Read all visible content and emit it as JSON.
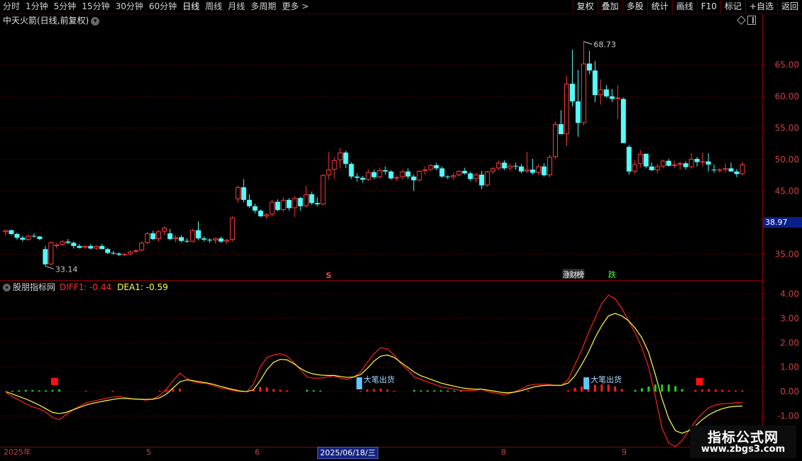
{
  "toolbar": {
    "periods": [
      "分时",
      "1分钟",
      "5分钟",
      "15分钟",
      "30分钟",
      "60分钟",
      "日线",
      "周线",
      "月线",
      "多周期",
      "更多 >"
    ],
    "buttons": [
      "复权",
      "叠加",
      "多股",
      "统计",
      "画线",
      "F10",
      "标记",
      "+自选",
      "返回"
    ]
  },
  "stock": {
    "title": "中天火箭(日线,前复权)"
  },
  "price_panel": {
    "y_ticks": [
      "65.00",
      "60.00",
      "55.00",
      "50.00",
      "45.00",
      "35.00"
    ],
    "high_label": "68.73",
    "low_label": "33.14",
    "current_price_tag": "38.97",
    "marker_s": "S",
    "event_labels": [
      "涨",
      "财",
      "榜",
      "跌"
    ]
  },
  "indicator_panel": {
    "name": "股朋指标网",
    "diff_label": "DIFF1: -0.44",
    "dea_label": "DEA1: -0.59",
    "y_ticks": [
      "4.00",
      "3.00",
      "2.00",
      "1.00",
      "0.00",
      "-1.00"
    ],
    "signal_label": "大笔出货"
  },
  "x_axis": {
    "labels": [
      "2025年",
      "5",
      "6",
      "8",
      "9"
    ],
    "cursor_date": "2025/06/18/三"
  },
  "watermark": {
    "title": "指标公式网",
    "url": "www.zbgs3.com"
  },
  "colors": {
    "up": "#ff3b3b",
    "down": "#54fcfc",
    "diff": "#ff2020",
    "dea": "#ffff40",
    "grid": "#8b0000",
    "axis_text": "#d04040"
  },
  "chart_data": [
    {
      "type": "candlestick",
      "title": "中天火箭(日线,前复权)",
      "ylim": [
        31,
        71
      ],
      "y_ticks": [
        35,
        45,
        50,
        55,
        60,
        65
      ],
      "candles": [
        [
          38.5,
          38.9,
          38.0,
          38.8
        ],
        [
          38.8,
          38.9,
          38.0,
          38.2
        ],
        [
          38.2,
          38.4,
          37.3,
          37.6
        ],
        [
          37.6,
          37.9,
          37.0,
          37.3
        ],
        [
          37.3,
          38.1,
          37.1,
          37.9
        ],
        [
          37.9,
          38.3,
          37.6,
          37.8
        ],
        [
          37.8,
          37.9,
          37.2,
          37.4
        ],
        [
          35.8,
          36.3,
          33.1,
          33.4
        ],
        [
          33.4,
          37.0,
          33.2,
          36.9
        ],
        [
          36.3,
          36.8,
          35.9,
          36.5
        ],
        [
          36.5,
          37.2,
          36.3,
          37.0
        ],
        [
          37.0,
          37.4,
          36.6,
          36.8
        ],
        [
          36.8,
          37.0,
          35.9,
          36.3
        ],
        [
          36.3,
          36.6,
          35.9,
          36.0
        ],
        [
          36.0,
          36.4,
          35.9,
          36.3
        ],
        [
          36.3,
          36.6,
          35.8,
          35.9
        ],
        [
          35.9,
          36.4,
          35.7,
          36.3
        ],
        [
          36.3,
          36.6,
          35.9,
          35.8
        ],
        [
          35.8,
          36.0,
          35.0,
          35.2
        ],
        [
          35.2,
          35.5,
          34.9,
          35.1
        ],
        [
          35.1,
          35.3,
          34.7,
          34.9
        ],
        [
          34.9,
          35.2,
          34.7,
          35.0
        ],
        [
          35.0,
          35.6,
          34.8,
          35.4
        ],
        [
          35.4,
          35.8,
          35.2,
          35.6
        ],
        [
          35.6,
          37.0,
          35.4,
          36.8
        ],
        [
          36.8,
          38.5,
          36.6,
          38.3
        ],
        [
          38.3,
          38.7,
          37.2,
          37.4
        ],
        [
          37.4,
          38.8,
          37.0,
          38.6
        ],
        [
          38.6,
          39.4,
          38.0,
          39.2
        ],
        [
          38.3,
          39.0,
          37.2,
          37.4
        ],
        [
          37.4,
          38.0,
          36.9,
          37.7
        ],
        [
          37.7,
          38.0,
          36.9,
          37.1
        ],
        [
          37.1,
          37.5,
          36.8,
          37.0
        ],
        [
          37.0,
          39.0,
          36.9,
          38.8
        ],
        [
          38.8,
          40.2,
          37.2,
          37.5
        ],
        [
          37.5,
          37.8,
          37.0,
          37.3
        ],
        [
          37.3,
          37.5,
          36.8,
          37.2
        ],
        [
          37.2,
          37.6,
          36.7,
          37.5
        ],
        [
          37.5,
          37.8,
          36.8,
          37.0
        ],
        [
          37.0,
          37.4,
          36.6,
          37.3
        ],
        [
          37.3,
          41.0,
          37.0,
          40.8
        ],
        [
          43.7,
          45.9,
          43.2,
          45.6
        ],
        [
          45.6,
          46.9,
          43.2,
          43.6
        ],
        [
          43.6,
          44.5,
          42.3,
          42.6
        ],
        [
          42.6,
          43.0,
          41.5,
          41.9
        ],
        [
          41.9,
          42.1,
          40.9,
          41.0
        ],
        [
          41.0,
          41.5,
          40.6,
          41.3
        ],
        [
          41.3,
          43.6,
          41.0,
          43.3
        ],
        [
          43.3,
          43.7,
          41.8,
          42.0
        ],
        [
          42.0,
          44.0,
          41.7,
          43.6
        ],
        [
          43.6,
          43.9,
          41.9,
          42.3
        ],
        [
          42.3,
          44.2,
          40.9,
          43.9
        ],
        [
          43.9,
          44.1,
          41.9,
          42.6
        ],
        [
          42.6,
          45.8,
          42.4,
          44.5
        ],
        [
          44.5,
          44.9,
          42.8,
          43.1
        ],
        [
          43.1,
          44.0,
          42.6,
          42.9
        ],
        [
          42.9,
          47.7,
          42.7,
          47.5
        ],
        [
          47.5,
          51.2,
          46.8,
          48.4
        ],
        [
          48.4,
          50.4,
          46.9,
          49.9
        ],
        [
          49.9,
          51.8,
          48.6,
          51.1
        ],
        [
          51.1,
          51.4,
          48.6,
          49.3
        ],
        [
          49.3,
          49.6,
          46.9,
          47.3
        ],
        [
          47.3,
          47.8,
          46.5,
          47.1
        ],
        [
          47.1,
          47.4,
          46.3,
          46.8
        ],
        [
          46.8,
          48.5,
          46.6,
          48.0
        ],
        [
          48.0,
          48.4,
          46.9,
          47.2
        ],
        [
          47.2,
          48.7,
          47.0,
          48.3
        ],
        [
          48.3,
          48.9,
          47.6,
          48.1
        ],
        [
          48.1,
          48.3,
          46.8,
          47.0
        ],
        [
          47.0,
          47.5,
          46.6,
          47.2
        ],
        [
          47.2,
          48.4,
          46.8,
          48.1
        ],
        [
          48.1,
          48.6,
          46.9,
          47.3
        ],
        [
          47.3,
          47.6,
          45.0,
          46.7
        ],
        [
          46.7,
          48.3,
          46.5,
          48.2
        ],
        [
          48.2,
          48.9,
          47.6,
          48.4
        ],
        [
          48.4,
          49.3,
          48.1,
          49.1
        ],
        [
          49.1,
          49.5,
          48.3,
          48.6
        ],
        [
          48.6,
          48.9,
          47.1,
          47.3
        ],
        [
          47.3,
          47.5,
          46.9,
          47.2
        ],
        [
          47.2,
          47.9,
          46.8,
          47.5
        ],
        [
          47.5,
          48.3,
          47.3,
          48.2
        ],
        [
          48.2,
          48.7,
          47.6,
          47.8
        ],
        [
          47.8,
          48.1,
          46.6,
          46.9
        ],
        [
          46.9,
          47.9,
          46.4,
          47.6
        ],
        [
          47.6,
          48.2,
          45.3,
          45.9
        ],
        [
          45.9,
          48.2,
          45.7,
          48.1
        ],
        [
          48.1,
          48.8,
          47.7,
          48.6
        ],
        [
          48.6,
          49.8,
          48.3,
          49.5
        ],
        [
          49.5,
          49.9,
          48.3,
          48.6
        ],
        [
          48.6,
          49.3,
          48.2,
          49.0
        ],
        [
          49.0,
          49.5,
          48.4,
          48.9
        ],
        [
          48.9,
          49.3,
          47.8,
          48.1
        ],
        [
          48.1,
          51.2,
          47.9,
          48.4
        ],
        [
          48.4,
          50.1,
          47.6,
          47.9
        ],
        [
          47.9,
          49.2,
          47.6,
          48.9
        ],
        [
          48.9,
          49.4,
          47.3,
          47.5
        ],
        [
          47.5,
          50.7,
          47.2,
          50.4
        ],
        [
          50.4,
          56.0,
          50.1,
          55.6
        ],
        [
          55.6,
          57.8,
          54.5,
          54.0
        ],
        [
          54.0,
          63.2,
          52.1,
          62.0
        ],
        [
          62.0,
          67.4,
          58.4,
          59.2
        ],
        [
          59.2,
          64.2,
          53.6,
          55.8
        ],
        [
          55.8,
          68.7,
          55.4,
          65.2
        ],
        [
          65.2,
          67.2,
          63.5,
          64.1
        ],
        [
          64.1,
          65.6,
          59.1,
          60.2
        ],
        [
          60.2,
          62.7,
          58.7,
          61.1
        ],
        [
          61.1,
          61.8,
          59.8,
          60.0
        ],
        [
          60.0,
          61.2,
          59.1,
          59.6
        ],
        [
          59.6,
          61.8,
          56.4,
          59.8
        ],
        [
          59.6,
          59.8,
          52.9,
          52.6
        ],
        [
          52.0,
          52.3,
          47.6,
          48.1
        ],
        [
          48.1,
          49.9,
          47.7,
          49.3
        ],
        [
          49.3,
          51.5,
          48.7,
          50.9
        ],
        [
          50.9,
          51.0,
          48.6,
          48.9
        ],
        [
          48.9,
          49.5,
          48.2,
          48.3
        ],
        [
          48.3,
          49.3,
          47.8,
          48.9
        ],
        [
          48.9,
          50.0,
          48.6,
          49.8
        ],
        [
          49.8,
          50.1,
          48.9,
          49.0
        ],
        [
          49.0,
          49.8,
          48.6,
          49.2
        ],
        [
          49.2,
          49.7,
          48.4,
          49.4
        ],
        [
          49.4,
          49.7,
          48.4,
          48.8
        ],
        [
          48.8,
          51.0,
          48.5,
          50.1
        ],
        [
          50.1,
          50.4,
          48.9,
          49.6
        ],
        [
          49.6,
          51.1,
          48.9,
          49.7
        ],
        [
          49.7,
          51.0,
          48.1,
          49.2
        ],
        [
          48.4,
          49.2,
          47.9,
          48.3
        ],
        [
          48.3,
          48.7,
          47.9,
          48.4
        ],
        [
          48.4,
          49.4,
          47.9,
          48.6
        ],
        [
          48.6,
          49.5,
          48.1,
          48.1
        ],
        [
          48.1,
          48.5,
          47.2,
          47.7
        ],
        [
          47.7,
          49.6,
          47.5,
          49.2
        ]
      ]
    },
    {
      "type": "line",
      "name": "股朋指标网",
      "ylim": [
        -2.2,
        4.3
      ],
      "y_ticks": [
        -1,
        0,
        1,
        2,
        3,
        4
      ],
      "series": [
        {
          "name": "DIFF1",
          "values": [
            -0.05,
            -0.2,
            -0.35,
            -0.5,
            -0.62,
            -0.7,
            -0.85,
            -1.05,
            -1.15,
            -0.95,
            -0.75,
            -0.6,
            -0.45,
            -0.4,
            -0.33,
            -0.27,
            -0.22,
            -0.2,
            -0.25,
            -0.3,
            -0.32,
            -0.35,
            -0.3,
            -0.15,
            0.1,
            0.45,
            0.75,
            0.55,
            0.4,
            0.35,
            0.33,
            0.25,
            0.15,
            0.1,
            0.05,
            0.0,
            0.0,
            0.3,
            1.0,
            1.4,
            1.5,
            1.55,
            1.45,
            1.2,
            0.9,
            0.6,
            0.55,
            0.55,
            0.6,
            0.65,
            0.55,
            0.5,
            0.6,
            0.8,
            1.2,
            1.55,
            1.8,
            1.75,
            1.5,
            1.15,
            0.9,
            0.6,
            0.5,
            0.4,
            0.3,
            0.2,
            0.15,
            0.1,
            0.05,
            0.05,
            0.05,
            0.1,
            0.0,
            -0.05,
            -0.1,
            -0.1,
            0.0,
            0.1,
            0.25,
            0.3,
            0.3,
            0.3,
            0.25,
            0.25,
            0.5,
            1.1,
            1.7,
            2.4,
            3.0,
            3.6,
            3.95,
            3.8,
            3.4,
            2.9,
            2.4,
            1.8,
            1.0,
            -0.2,
            -1.5,
            -2.1,
            -2.25,
            -2.0,
            -1.6,
            -1.2,
            -0.9,
            -0.65,
            -0.55,
            -0.5,
            -0.48,
            -0.46,
            -0.44
          ]
        },
        {
          "name": "DEA1",
          "values": [
            0.0,
            -0.1,
            -0.2,
            -0.3,
            -0.42,
            -0.55,
            -0.7,
            -0.85,
            -0.9,
            -0.85,
            -0.75,
            -0.65,
            -0.55,
            -0.48,
            -0.42,
            -0.37,
            -0.32,
            -0.28,
            -0.28,
            -0.3,
            -0.31,
            -0.32,
            -0.31,
            -0.25,
            -0.1,
            0.15,
            0.4,
            0.48,
            0.45,
            0.4,
            0.36,
            0.3,
            0.22,
            0.15,
            0.08,
            0.03,
            0.0,
            0.08,
            0.45,
            0.9,
            1.2,
            1.32,
            1.3,
            1.15,
            0.95,
            0.8,
            0.72,
            0.68,
            0.66,
            0.66,
            0.62,
            0.58,
            0.6,
            0.7,
            0.95,
            1.25,
            1.45,
            1.5,
            1.4,
            1.2,
            1.0,
            0.8,
            0.65,
            0.55,
            0.45,
            0.35,
            0.28,
            0.22,
            0.16,
            0.12,
            0.1,
            0.1,
            0.06,
            0.02,
            -0.03,
            -0.05,
            -0.02,
            0.04,
            0.12,
            0.2,
            0.24,
            0.26,
            0.26,
            0.26,
            0.35,
            0.65,
            1.1,
            1.6,
            2.2,
            2.7,
            3.1,
            3.2,
            3.1,
            2.9,
            2.6,
            2.2,
            1.6,
            0.7,
            -0.3,
            -1.1,
            -1.6,
            -1.7,
            -1.6,
            -1.4,
            -1.15,
            -0.95,
            -0.8,
            -0.7,
            -0.63,
            -0.6,
            -0.59
          ]
        }
      ]
    }
  ]
}
